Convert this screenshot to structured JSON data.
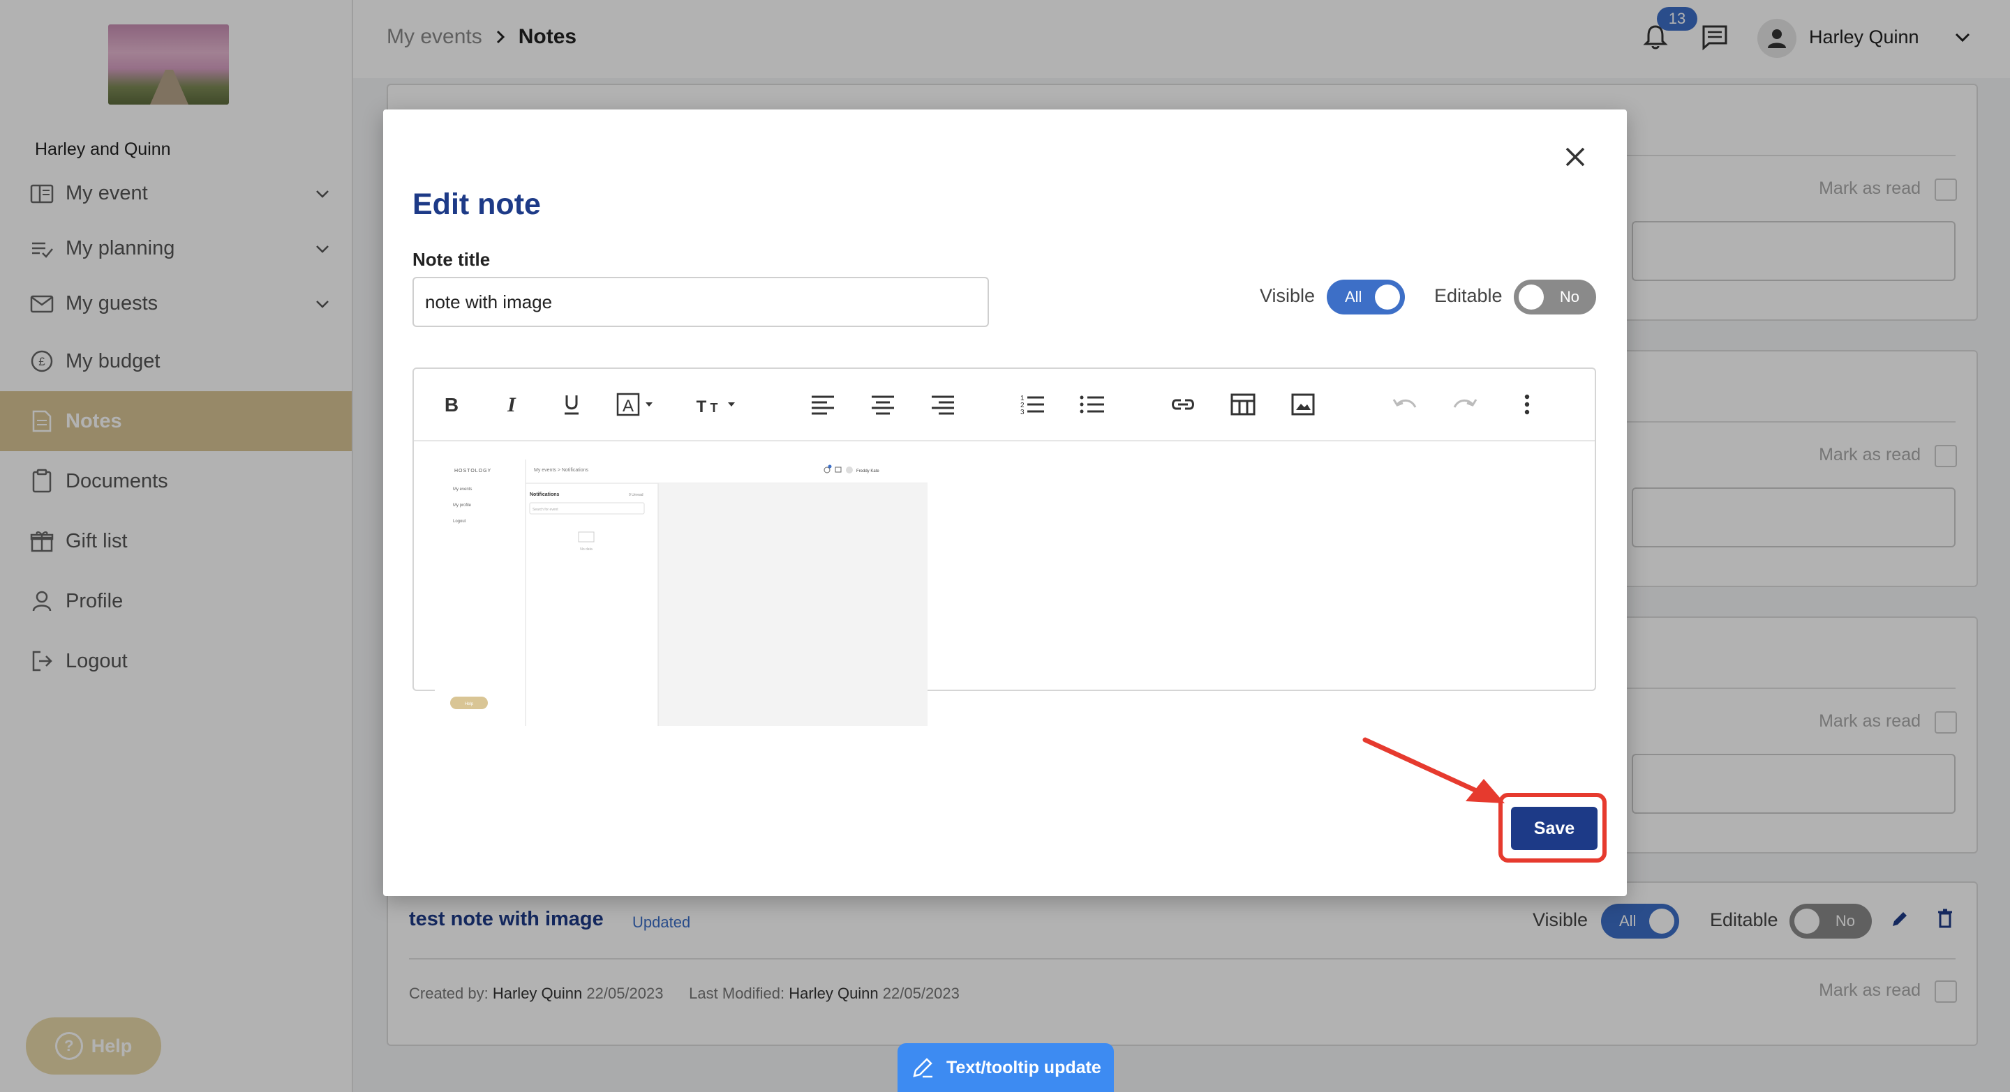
{
  "sidebar": {
    "brand_name": "Harley and Quinn",
    "items": [
      {
        "label": "My event",
        "icon": "book-icon",
        "expandable": true
      },
      {
        "label": "My planning",
        "icon": "checklist-icon",
        "expandable": true
      },
      {
        "label": "My guests",
        "icon": "mail-icon",
        "expandable": true
      },
      {
        "label": "My budget",
        "icon": "pound-icon",
        "expandable": false
      },
      {
        "label": "Notes",
        "icon": "notes-icon",
        "expandable": false,
        "active": true
      },
      {
        "label": "Documents",
        "icon": "clipboard-icon",
        "expandable": false
      },
      {
        "label": "Gift list",
        "icon": "gift-icon",
        "expandable": false
      },
      {
        "label": "Profile",
        "icon": "person-icon",
        "expandable": false
      },
      {
        "label": "Logout",
        "icon": "logout-icon",
        "expandable": false
      }
    ],
    "help_label": "Help"
  },
  "header": {
    "breadcrumb": [
      "My events",
      "Notes"
    ],
    "notification_count": "13",
    "user_name": "Harley Quinn"
  },
  "background_cards": {
    "mark_as_read": "Mark as read"
  },
  "bottom_note": {
    "title": "test note with image",
    "status": "Updated",
    "visible_label": "Visible",
    "visible_value": "All",
    "editable_label": "Editable",
    "editable_value": "No",
    "created_by_label": "Created by:",
    "created_by_name": "Harley Quinn",
    "created_date": "22/05/2023",
    "modified_label": "Last Modified:",
    "modified_name": "Harley Quinn",
    "modified_date": "22/05/2023",
    "mark_as_read": "Mark as read"
  },
  "modal": {
    "title": "Edit note",
    "note_title_label": "Note title",
    "note_title_value": "note with image",
    "visible_label": "Visible",
    "visible_value": "All",
    "editable_label": "Editable",
    "editable_value": "No",
    "save_label": "Save",
    "toolbar": [
      "bold-icon",
      "italic-icon",
      "underline-icon",
      "font-color-icon",
      "font-size-icon",
      "align-left-icon",
      "align-center-icon",
      "align-right-icon",
      "numbered-list-icon",
      "bullet-list-icon",
      "link-icon",
      "table-icon",
      "image-icon",
      "undo-icon",
      "redo-icon",
      "more-icon"
    ],
    "embedded_screenshot": {
      "brand": "HOSTOLOGY",
      "breadcrumb": "My events  >  Notifications",
      "user": "Freddy Kate",
      "menu": [
        "My events",
        "My profile",
        "Logout"
      ],
      "panel_title": "Notifications",
      "panel_action": "0 Unread",
      "search_placeholder": "Search for event",
      "empty_text": "No data",
      "help": "Help"
    }
  },
  "feedback_tab": "Text/tooltip update",
  "colors": {
    "accent": "#1d3a87",
    "gold": "#d9c595",
    "toggle_on": "#3d6fc7",
    "highlight": "#e63a2e"
  }
}
